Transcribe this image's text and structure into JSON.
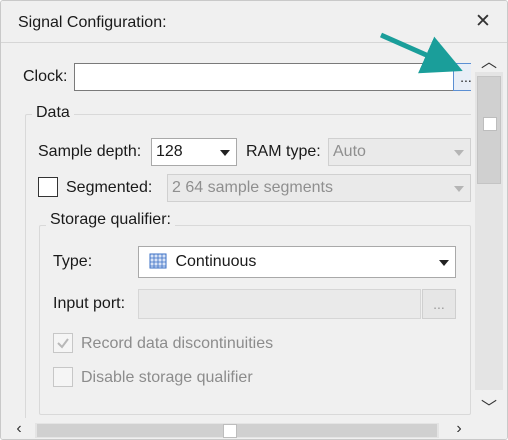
{
  "dialog": {
    "title": "Signal Configuration:",
    "close_icon": "close-icon"
  },
  "clock": {
    "label": "Clock:",
    "value": "",
    "browse_label": "..."
  },
  "data_group": {
    "title": "Data",
    "sample_depth": {
      "label": "Sample depth:",
      "value": "128"
    },
    "ram_type": {
      "label": "RAM type:",
      "value": "Auto"
    },
    "segmented": {
      "label": "Segmented:",
      "checked": false,
      "value": "2  64 sample segments"
    }
  },
  "storage_qualifier": {
    "title": "Storage qualifier:",
    "type": {
      "label": "Type:",
      "value": "Continuous",
      "icon": "continuous-pattern-icon"
    },
    "input_port": {
      "label": "Input port:",
      "value": "",
      "browse_label": "..."
    },
    "record_discontinuities": {
      "label": "Record data discontinuities",
      "checked": true
    },
    "disable_qualifier": {
      "label": "Disable storage qualifier",
      "checked": false
    }
  },
  "colors": {
    "annotation_arrow": "#1a9e9a",
    "browse_highlight": "#5b8fd3"
  }
}
